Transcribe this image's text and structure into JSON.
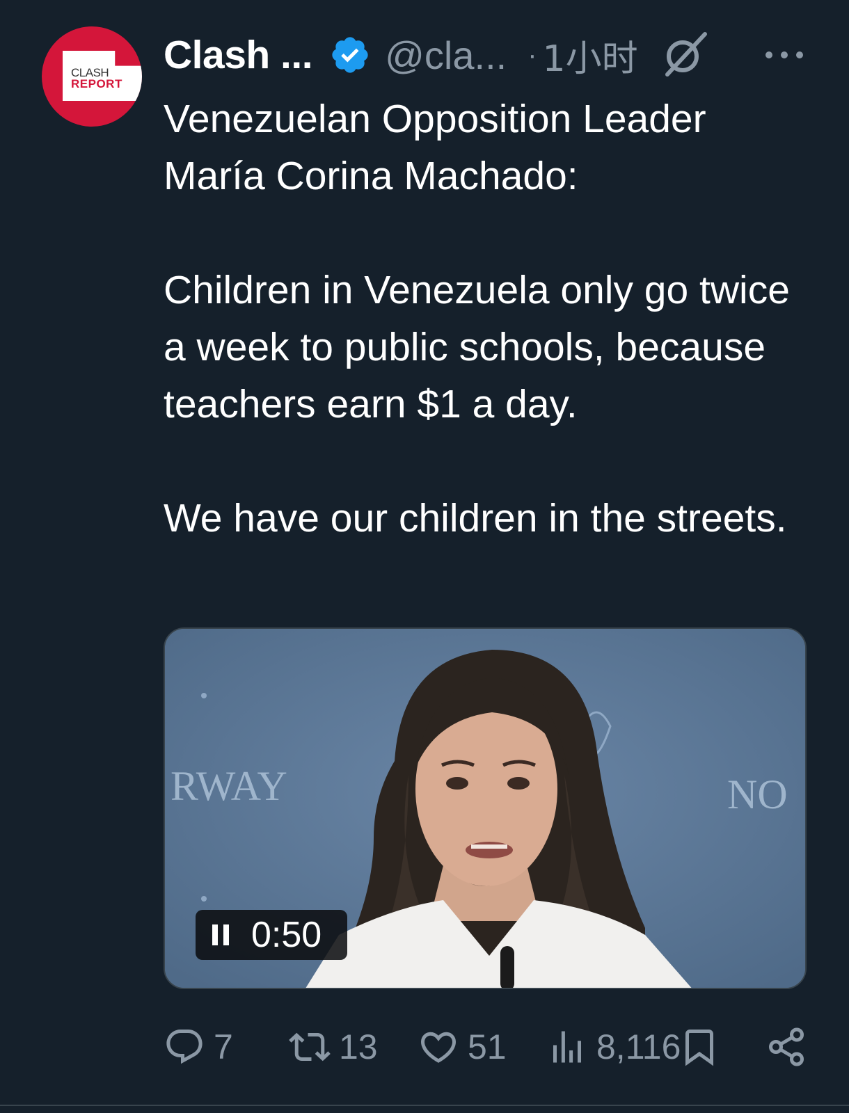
{
  "author": {
    "avatar_line1": "CLASH",
    "avatar_line2": "REPORT",
    "display_name": "Clash ...",
    "handle": "@cla...",
    "separator": "·",
    "time": "1小时"
  },
  "tweet": {
    "paragraphs": [
      "Venezuelan Opposition Leader María Corina Machado:",
      "Children in Venezuela only go twice a week to public schools, because teachers earn $1 a day.",
      "We have our children in the streets."
    ]
  },
  "media": {
    "type": "video",
    "state": "playing",
    "duration": "0:50",
    "backdrop_text_left": "RWAY",
    "backdrop_text_right": "NO"
  },
  "actions": {
    "replies": "7",
    "reposts": "13",
    "likes": "51",
    "views": "8,116"
  },
  "colors": {
    "background": "#15202b",
    "text": "#ffffff",
    "secondary": "#8b98a5",
    "verified": "#1d9bf0",
    "brand": "#d4163a",
    "divider": "#38444d"
  },
  "icons": [
    "verified-badge-icon",
    "grok-icon",
    "more-icon",
    "pause-icon",
    "reply-icon",
    "repost-icon",
    "like-icon",
    "views-icon",
    "bookmark-icon",
    "share-icon"
  ]
}
